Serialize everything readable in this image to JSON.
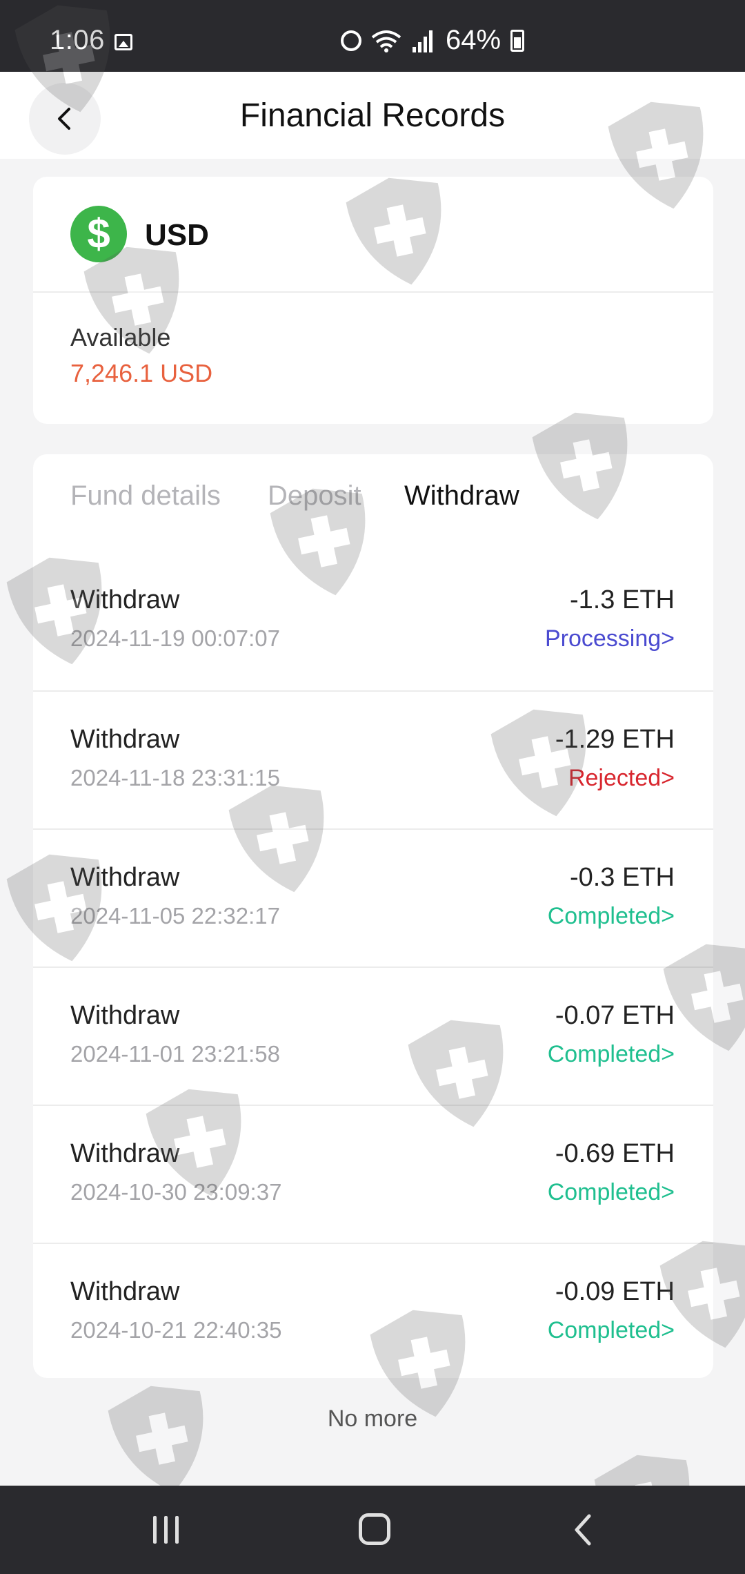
{
  "status_bar": {
    "time": "1:06",
    "battery": "64%"
  },
  "header": {
    "title": "Financial Records"
  },
  "account": {
    "currency": "USD",
    "available_label": "Available",
    "available_value": "7,246.1 USD"
  },
  "tabs": [
    "Fund details",
    "Deposit",
    "Withdraw"
  ],
  "active_tab": "Withdraw",
  "records": [
    {
      "type": "Withdraw",
      "date": "2024-11-19 00:07:07",
      "amount": "-1.3 ETH",
      "status": "Processing>",
      "status_color": "#4a4ad0"
    },
    {
      "type": "Withdraw",
      "date": "2024-11-18 23:31:15",
      "amount": "-1.29 ETH",
      "status": "Rejected>",
      "status_color": "#d8262e"
    },
    {
      "type": "Withdraw",
      "date": "2024-11-05 22:32:17",
      "amount": "-0.3 ETH",
      "status": "Completed>",
      "status_color": "#1fbf8f"
    },
    {
      "type": "Withdraw",
      "date": "2024-11-01 23:21:58",
      "amount": "-0.07 ETH",
      "status": "Completed>",
      "status_color": "#1fbf8f"
    },
    {
      "type": "Withdraw",
      "date": "2024-10-30 23:09:37",
      "amount": "-0.69 ETH",
      "status": "Completed>",
      "status_color": "#1fbf8f"
    },
    {
      "type": "Withdraw",
      "date": "2024-10-21 22:40:35",
      "amount": "-0.09 ETH",
      "status": "Completed>",
      "status_color": "#1fbf8f"
    }
  ],
  "footer": {
    "no_more": "No more"
  },
  "icons": {
    "back": "chevron-left-icon",
    "currency": "dollar-icon",
    "watermark": "shield-plus-icon"
  }
}
